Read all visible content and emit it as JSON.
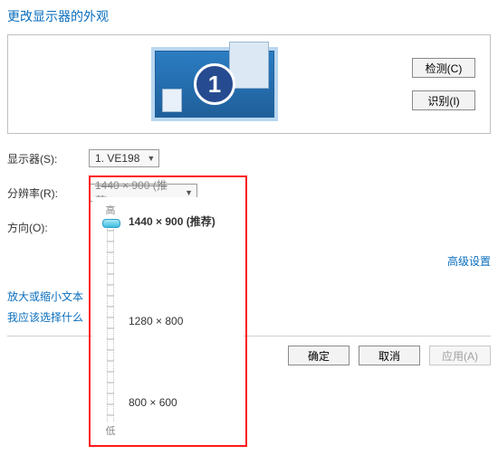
{
  "title": "更改显示器的外观",
  "preview": {
    "monitor_number": "1"
  },
  "buttons": {
    "detect": "检测(C)",
    "identify": "识别(I)",
    "ok": "确定",
    "cancel": "取消",
    "apply": "应用(A)"
  },
  "labels": {
    "display": "显示器(S):",
    "resolution": "分辨率(R):",
    "orientation": "方向(O):"
  },
  "display_dropdown": {
    "value": "1. VE198"
  },
  "resolution_dropdown": {
    "value": "1440 × 900 (推荐)"
  },
  "slider": {
    "high": "高",
    "low": "低",
    "opt_recommended": "1440 × 900 (推荐)",
    "opt_mid": "1280 × 800",
    "opt_low": "800 × 600"
  },
  "links": {
    "advanced": "高级设置",
    "zoom_text": "放大或缩小文本",
    "which_choose": "我应该选择什么"
  }
}
